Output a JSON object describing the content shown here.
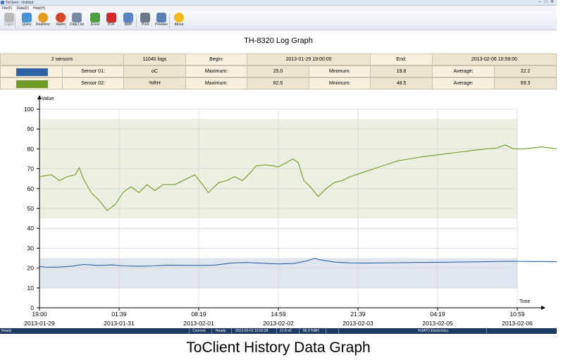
{
  "window": {
    "title": "ToClient - Untitled",
    "minimize": "–",
    "maximize": "□",
    "close": "✕"
  },
  "menu": [
    "File(F)",
    "Data(D)",
    "Help(H)"
  ],
  "toolbar": [
    {
      "label": "Logon",
      "icon": "logon-icon",
      "color": "#b9b9b9",
      "disabled": true
    },
    {
      "label": "Query",
      "icon": "query-icon",
      "color": "#4a90d9"
    },
    {
      "label": "Realtime",
      "icon": "realtime-icon",
      "color": "#e59b1d"
    },
    {
      "label": "Alarm",
      "icon": "alarm-icon",
      "color": "#d9472b"
    },
    {
      "label": "Data List",
      "icon": "data-list-icon",
      "color": "#7a8aa6"
    },
    {
      "label": "Excel",
      "icon": "excel-icon",
      "color": "#4f9a42"
    },
    {
      "label": "PDF",
      "icon": "pdf-icon",
      "color": "#d32a2a"
    },
    {
      "label": "BMP",
      "icon": "bmp-icon",
      "color": "#5b84c4"
    },
    {
      "label": "Print",
      "icon": "print-icon",
      "color": "#6b7686"
    },
    {
      "label": "Preview",
      "icon": "preview-icon",
      "color": "#5a7fb2"
    },
    {
      "label": "About",
      "icon": "about-icon",
      "color": "#f1b91c"
    }
  ],
  "graph_title": "TH-8320 Log Graph",
  "summary": {
    "sensors": "2 sensors",
    "logs": "11040 logs",
    "begin_label": "Begin:",
    "begin": "2013-01-29 19:00:00",
    "end_label": "End:",
    "end": "2013-02-06 10:59:00"
  },
  "sensors": [
    {
      "name": "Sensor 01:",
      "unit": "oC",
      "max_label": "Maximum:",
      "max": "25.0",
      "min_label": "Minimum:",
      "min": "19.8",
      "avg_label": "Average:",
      "avg": "22.2",
      "color": "#2e64a6"
    },
    {
      "name": "Sensor 02:",
      "unit": "%RH",
      "max_label": "Maximum:",
      "max": "82.6",
      "min_label": "Minimum:",
      "min": "48.5",
      "avg_label": "Average:",
      "avg": "69.3",
      "color": "#6f9a2a"
    }
  ],
  "chart_data": {
    "type": "line",
    "ylabel": "Value",
    "xlabel": "Time",
    "ylim": [
      0,
      100
    ],
    "yticks": [
      0,
      10,
      20,
      30,
      40,
      50,
      60,
      70,
      80,
      90,
      100
    ],
    "xticks": [
      {
        "time": "19:00",
        "date": "2013-01-29"
      },
      {
        "time": "01:39",
        "date": "2013-01-31"
      },
      {
        "time": "08:19",
        "date": "2013-02-01"
      },
      {
        "time": "14:59",
        "date": "2013-02-02"
      },
      {
        "time": "21:39",
        "date": "2013-02-03"
      },
      {
        "time": "04:19",
        "date": "2013-02-05"
      },
      {
        "time": "10:59",
        "date": "2013-02-06"
      }
    ],
    "bands": [
      {
        "series": "Sensor 01",
        "low": 10,
        "high": 25,
        "color": "#dfe6ef"
      },
      {
        "series": "Sensor 02",
        "low": 45,
        "high": 95,
        "color": "#ecf0e0"
      }
    ],
    "series": [
      {
        "name": "Sensor 01",
        "color": "#2e64a6",
        "points": [
          [
            0,
            20.8
          ],
          [
            0.1,
            20.4
          ],
          [
            0.25,
            20.5
          ],
          [
            0.42,
            21
          ],
          [
            0.55,
            21.8
          ],
          [
            0.75,
            21.3
          ],
          [
            0.9,
            21.6
          ],
          [
            1.05,
            21.1
          ],
          [
            1.25,
            20.9
          ],
          [
            1.45,
            21.1
          ],
          [
            1.6,
            21.5
          ],
          [
            1.8,
            21.4
          ],
          [
            2.0,
            21.3
          ],
          [
            2.2,
            21.5
          ],
          [
            2.4,
            22.5
          ],
          [
            2.6,
            22.8
          ],
          [
            2.8,
            22.4
          ],
          [
            3.0,
            22.1
          ],
          [
            3.2,
            22.3
          ],
          [
            3.35,
            23.5
          ],
          [
            3.45,
            24.8
          ],
          [
            3.55,
            24
          ],
          [
            3.7,
            23
          ],
          [
            3.9,
            22.6
          ],
          [
            4.1,
            22.5
          ],
          [
            4.3,
            22.6
          ],
          [
            4.5,
            22.7
          ],
          [
            4.7,
            22.8
          ],
          [
            5.0,
            22.9
          ],
          [
            5.3,
            23
          ],
          [
            5.6,
            23.2
          ],
          [
            5.9,
            23.4
          ],
          [
            6.2,
            23.3
          ],
          [
            6.5,
            23.2
          ],
          [
            6.75,
            23.2
          ],
          [
            6.87,
            23.4
          ]
        ]
      },
      {
        "name": "Sensor 02",
        "color": "#6f9a2a",
        "points": [
          [
            0,
            66
          ],
          [
            0.15,
            67
          ],
          [
            0.25,
            64
          ],
          [
            0.35,
            66
          ],
          [
            0.45,
            67
          ],
          [
            0.5,
            70.5
          ],
          [
            0.55,
            65
          ],
          [
            0.65,
            58
          ],
          [
            0.75,
            54
          ],
          [
            0.85,
            49
          ],
          [
            0.95,
            52
          ],
          [
            1.05,
            58
          ],
          [
            1.15,
            61
          ],
          [
            1.25,
            58
          ],
          [
            1.35,
            62
          ],
          [
            1.45,
            59
          ],
          [
            1.55,
            62
          ],
          [
            1.7,
            62
          ],
          [
            1.85,
            65
          ],
          [
            1.95,
            67
          ],
          [
            2.05,
            62
          ],
          [
            2.12,
            58
          ],
          [
            2.25,
            63
          ],
          [
            2.35,
            64
          ],
          [
            2.45,
            66
          ],
          [
            2.55,
            64
          ],
          [
            2.65,
            68
          ],
          [
            2.72,
            71.5
          ],
          [
            2.85,
            72
          ],
          [
            3.0,
            71
          ],
          [
            3.1,
            73
          ],
          [
            3.18,
            75
          ],
          [
            3.25,
            73
          ],
          [
            3.32,
            64
          ],
          [
            3.4,
            61
          ],
          [
            3.5,
            56
          ],
          [
            3.6,
            60
          ],
          [
            3.7,
            63
          ],
          [
            3.8,
            64
          ],
          [
            3.9,
            66
          ],
          [
            4.05,
            68
          ],
          [
            4.2,
            70
          ],
          [
            4.35,
            72
          ],
          [
            4.5,
            74
          ],
          [
            4.65,
            75
          ],
          [
            4.8,
            76
          ],
          [
            5.0,
            77
          ],
          [
            5.2,
            78
          ],
          [
            5.4,
            79
          ],
          [
            5.6,
            80
          ],
          [
            5.75,
            80.5
          ],
          [
            5.85,
            82
          ],
          [
            5.95,
            80
          ],
          [
            6.1,
            80
          ],
          [
            6.3,
            81
          ],
          [
            6.5,
            80
          ],
          [
            6.65,
            79
          ],
          [
            6.87,
            77
          ]
        ]
      }
    ]
  },
  "statusbar": {
    "left": "Ready",
    "connect": "Connect",
    "state": "Ready",
    "datetime": "2013-02-01 10:50:28",
    "temp": "21.8 oC",
    "humidity": "66.9 %RH",
    "company": "HUATO Electronics."
  },
  "caption": "ToClient History Data Graph"
}
